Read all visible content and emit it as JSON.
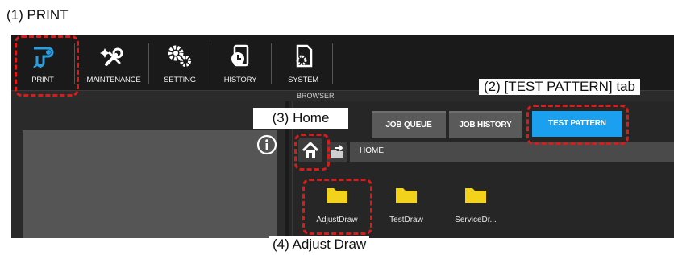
{
  "annotations": {
    "print": "(1) PRINT",
    "test_pattern_tab": "(2) [TEST PATTERN] tab",
    "home": "(3) Home",
    "adjust_draw": "(4) Adjust Draw"
  },
  "toolbar": {
    "items": [
      {
        "label": "PRINT",
        "icon": "print-icon"
      },
      {
        "label": "MAINTENANCE",
        "icon": "wrench-sparkle-icon"
      },
      {
        "label": "SETTING",
        "icon": "gears-icon"
      },
      {
        "label": "HISTORY",
        "icon": "history-clock-icon"
      },
      {
        "label": "SYSTEM",
        "icon": "system-gear-document-icon"
      }
    ]
  },
  "panels": {
    "browser_label": "BROWSER"
  },
  "tabs": [
    {
      "label": "JOB QUEUE",
      "active": false
    },
    {
      "label": "JOB HISTORY",
      "active": false
    },
    {
      "label": "TEST PATTERN",
      "active": true
    }
  ],
  "path": {
    "current": "HOME"
  },
  "folders": [
    {
      "name": "AdjustDraw"
    },
    {
      "name": "TestDraw"
    },
    {
      "name": "ServiceDr..."
    }
  ],
  "colors": {
    "accent": "#1aa0ee",
    "annotation": "#d81c1c",
    "folder": "#f2d21b",
    "background": "#1c1c1c"
  }
}
